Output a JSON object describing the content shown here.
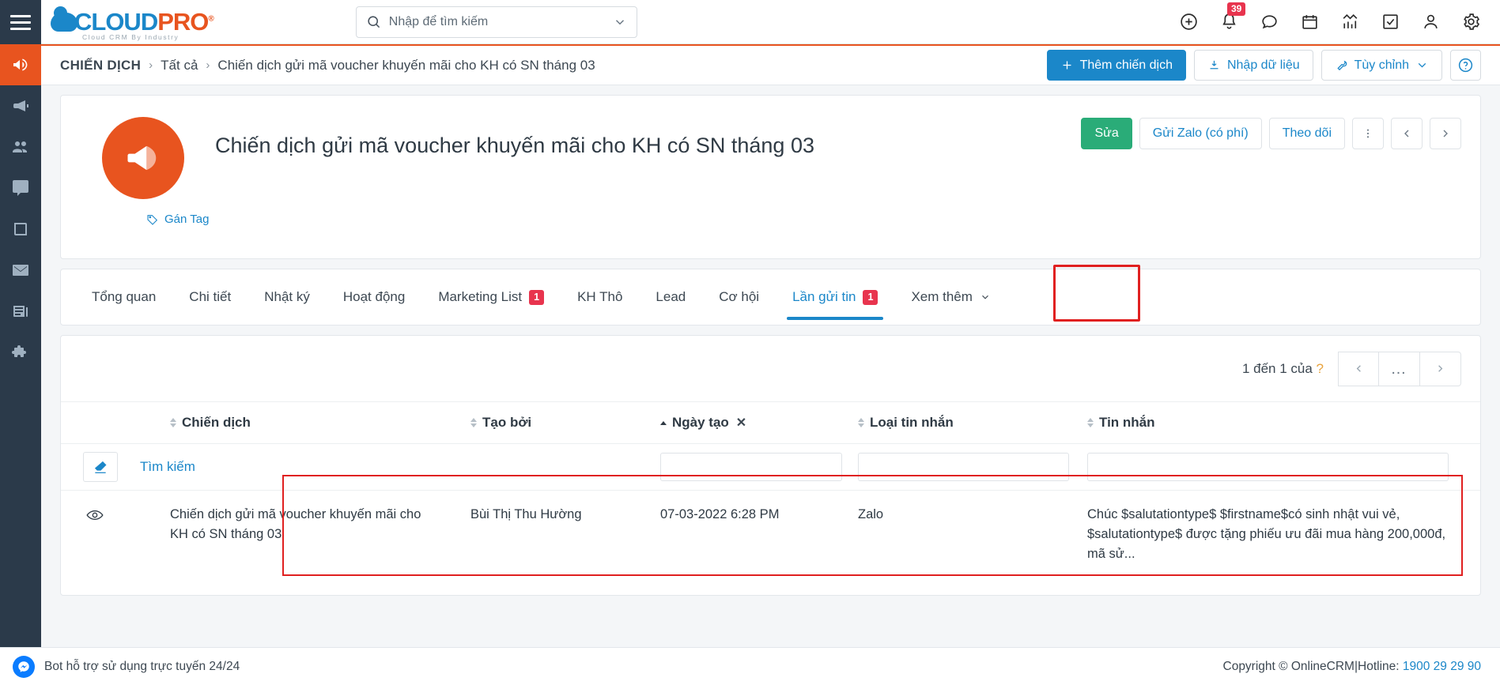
{
  "colors": {
    "brand_blue": "#1b87c9",
    "brand_orange": "#e8541f",
    "green": "#2aac78",
    "badge_red": "#e8344e",
    "highlight_red": "#e02020"
  },
  "topbar": {
    "logo": {
      "cloud": "CLOUD",
      "pro": "PRO",
      "reg": "®",
      "tagline": "Cloud CRM By Industry"
    },
    "search": {
      "placeholder": "Nhập để tìm kiếm",
      "value": ""
    },
    "icons": [
      {
        "name": "add-circle-icon",
        "badge": ""
      },
      {
        "name": "bell-icon",
        "badge": "39"
      },
      {
        "name": "chat-icon",
        "badge": ""
      },
      {
        "name": "calendar-icon",
        "badge": ""
      },
      {
        "name": "analytics-icon",
        "badge": ""
      },
      {
        "name": "task-checkbox-icon",
        "badge": ""
      },
      {
        "name": "user-icon",
        "badge": ""
      },
      {
        "name": "gear-icon",
        "badge": ""
      }
    ]
  },
  "sidebar": {
    "items": [
      {
        "name": "megaphone-icon",
        "active": true
      },
      {
        "name": "announcement-icon",
        "active": false
      },
      {
        "name": "contacts-icon",
        "active": false
      },
      {
        "name": "chat-icon",
        "active": false
      },
      {
        "name": "book-icon",
        "active": false
      },
      {
        "name": "mail-icon",
        "active": false
      },
      {
        "name": "news-icon",
        "active": false
      },
      {
        "name": "puzzle-icon",
        "active": false
      }
    ]
  },
  "breadcrumb": {
    "root": "CHIẾN DỊCH",
    "sep": "›",
    "middle": "Tất cả",
    "current": "Chiến dịch gửi mã voucher khuyến mãi cho KH có SN tháng 03"
  },
  "toolbar": {
    "add_campaign": "Thêm chiến dịch",
    "import_data": "Nhập dữ liệu",
    "customize": "Tùy chỉnh",
    "help": "?"
  },
  "record": {
    "title": "Chiến dịch gửi mã voucher khuyến mãi cho KH có SN tháng 03",
    "tag_link": "Gán Tag",
    "actions": {
      "edit": "Sửa",
      "send_zalo": "Gửi Zalo (có phí)",
      "follow": "Theo dõi"
    }
  },
  "tabs": [
    {
      "label": "Tổng quan",
      "badge": "",
      "active": false,
      "chevron": false
    },
    {
      "label": "Chi tiết",
      "badge": "",
      "active": false,
      "chevron": false
    },
    {
      "label": "Nhật ký",
      "badge": "",
      "active": false,
      "chevron": false
    },
    {
      "label": "Hoạt động",
      "badge": "",
      "active": false,
      "chevron": false
    },
    {
      "label": "Marketing List",
      "badge": "1",
      "active": false,
      "chevron": false
    },
    {
      "label": "KH Thô",
      "badge": "",
      "active": false,
      "chevron": false
    },
    {
      "label": "Lead",
      "badge": "",
      "active": false,
      "chevron": false
    },
    {
      "label": "Cơ hội",
      "badge": "",
      "active": false,
      "chevron": false
    },
    {
      "label": "Lần gửi tin",
      "badge": "1",
      "active": true,
      "chevron": false
    },
    {
      "label": "Xem thêm",
      "badge": "",
      "active": false,
      "chevron": true
    }
  ],
  "grid": {
    "pager_text": "1 đến 1 của",
    "pager_unknown": "?",
    "pager_dots": "…",
    "search_label": "Tìm kiếm",
    "columns": [
      {
        "label": "Chiến dịch",
        "sort": "none",
        "clearable": false
      },
      {
        "label": "Tạo bởi",
        "sort": "none",
        "clearable": false
      },
      {
        "label": "Ngày tạo",
        "sort": "asc",
        "clearable": true
      },
      {
        "label": "Loại tin nhắn",
        "sort": "none",
        "clearable": false
      },
      {
        "label": "Tin nhắn",
        "sort": "none",
        "clearable": false
      }
    ],
    "rows": [
      {
        "campaign": "Chiến dịch gửi mã voucher khuyến mãi cho KH có SN tháng 03",
        "created_by": "Bùi Thị Thu Hường",
        "created_date": "07-03-2022 6:28 PM",
        "message_type": "Zalo",
        "message": "Chúc $salutationtype$ $firstname$có sinh nhật vui vẻ, $salutationtype$ được tặng phiếu ưu đãi mua hàng 200,000đ, mã sử..."
      }
    ]
  },
  "footer": {
    "left": "Bot hỗ trợ sử dụng trực tuyến 24/24",
    "copyright": "Copyright © OnlineCRM|Hotline: ",
    "hotline": "1900 29 29 90"
  }
}
